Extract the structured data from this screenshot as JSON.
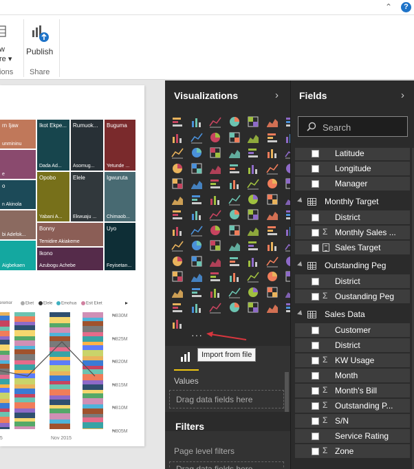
{
  "ribbon": {
    "up_chevron": "⌃",
    "help": "?",
    "partial_button_line1": "w",
    "partial_button_line2": "re ▾",
    "publish_label": "Publish",
    "group_left": "tions",
    "group_share": "Share"
  },
  "report": {
    "treemap_tiles": [
      {
        "label": "rn Ijaw",
        "sub": "unmininu",
        "color": "#c0785a"
      },
      {
        "label": "",
        "sub": "e",
        "color": "#8a4a6e"
      },
      {
        "label": "o",
        "sub": "n Akinola",
        "color": "#1c4a58"
      },
      {
        "label": "",
        "sub": "bi Adefok...",
        "color": "#8b6a60"
      },
      {
        "label": "",
        "sub": "Aigbekaen",
        "color": "#14a8a0"
      },
      {
        "label": "Ikot Ekpe...",
        "sub": "Dada Ad...",
        "color": "#17454d"
      },
      {
        "label": "Rumuok...",
        "sub": "Asomug...",
        "color": "#283036"
      },
      {
        "label": "Buguma",
        "sub": "Yetunde ...",
        "color": "#7a2a2c"
      },
      {
        "label": "Opobo",
        "sub": "Yabani A...",
        "color": "#77701a"
      },
      {
        "label": "Elele",
        "sub": "Ekwuaju ...",
        "color": "#31383c"
      },
      {
        "label": "Igwuruta",
        "sub": "Chimaob...",
        "color": "#486a72"
      },
      {
        "label": "Bonny",
        "sub": "Temidire Akiakeme",
        "color": "#8b5e56"
      },
      {
        "label": "Uyo",
        "sub": "Feyisetan...",
        "color": "#0e2e36"
      },
      {
        "label": "Ikono",
        "sub": "Azubogu Achebe",
        "color": "#552b4a"
      }
    ],
    "legend": [
      {
        "label": "keremor",
        "color": "#e0c080"
      },
      {
        "label": "Eket",
        "color": "#aaaaaa"
      },
      {
        "label": "Elele",
        "color": "#333333"
      },
      {
        "label": "Emohua",
        "color": "#40b0c0"
      },
      {
        "label": "Esit Eket",
        "color": "#d080a0"
      }
    ],
    "legend_more": "▸",
    "chart_data": {
      "type": "bar",
      "x_ticks": [
        "15",
        "Nov 2015"
      ],
      "y_ticks": [
        "₦830M",
        "₦825M",
        "₦820M",
        "₦815M",
        "₦810M",
        "₦805M"
      ],
      "ylim": [
        805,
        830
      ]
    }
  },
  "visualizations": {
    "title": "Visualizations",
    "chevron": "›",
    "more_button": "···",
    "tooltip": "Import from file",
    "values_label": "Values",
    "drag_hint": "Drag data fields here"
  },
  "filters": {
    "title": "Filters",
    "page_level": "Page level filters",
    "drag_hint": "Drag data fields here"
  },
  "fields": {
    "title": "Fields",
    "chevron": "›",
    "search_placeholder": "Search",
    "items": [
      {
        "kind": "field",
        "label": "Latitude",
        "icon": "none"
      },
      {
        "kind": "field",
        "label": "Longitude",
        "icon": "none"
      },
      {
        "kind": "field",
        "label": "Manager",
        "icon": "none"
      },
      {
        "kind": "table",
        "label": "Monthly Target"
      },
      {
        "kind": "field",
        "label": "District",
        "icon": "none"
      },
      {
        "kind": "field",
        "label": "Monthly Sales ...",
        "icon": "sigma"
      },
      {
        "kind": "field",
        "label": "Sales Target",
        "icon": "calc"
      },
      {
        "kind": "table",
        "label": "Outstanding Peg"
      },
      {
        "kind": "field",
        "label": "District",
        "icon": "none"
      },
      {
        "kind": "field",
        "label": "Oustanding Peg",
        "icon": "sigma"
      },
      {
        "kind": "table",
        "label": "Sales Data"
      },
      {
        "kind": "field",
        "label": "Customer",
        "icon": "none"
      },
      {
        "kind": "field",
        "label": "District",
        "icon": "none"
      },
      {
        "kind": "field",
        "label": "KW Usage",
        "icon": "sigma"
      },
      {
        "kind": "field",
        "label": "Month",
        "icon": "none"
      },
      {
        "kind": "field",
        "label": "Month's Bill",
        "icon": "sigma"
      },
      {
        "kind": "field",
        "label": "Outstanding P...",
        "icon": "sigma"
      },
      {
        "kind": "field",
        "label": "S/N",
        "icon": "sigma"
      },
      {
        "kind": "field",
        "label": "Service Rating",
        "icon": "none"
      },
      {
        "kind": "field",
        "label": "Zone",
        "icon": "sigma"
      }
    ]
  },
  "colors": {
    "accent": "#f2c811",
    "pane_bg": "#2b2b2b",
    "arrow": "#d9363e"
  }
}
